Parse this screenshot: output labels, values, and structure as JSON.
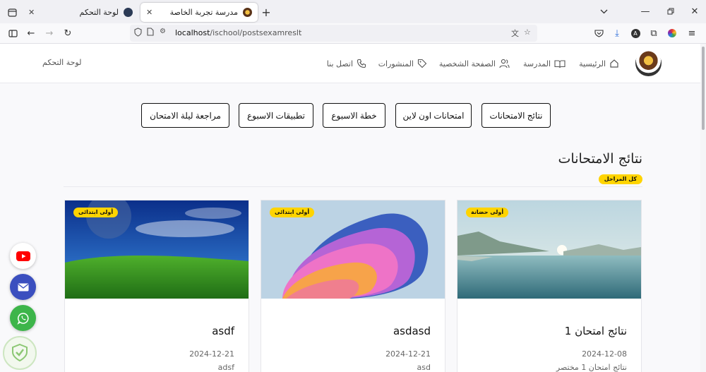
{
  "browser": {
    "tabs": [
      {
        "title": "لوحة التحكم",
        "active": false
      },
      {
        "title": "مدرسة تجربة الخاصة",
        "active": true
      }
    ],
    "url_host": "localhost",
    "url_path": "/ischool/postsexamreslt"
  },
  "header": {
    "menu": [
      {
        "label": "الرئيسية",
        "icon": "home-icon"
      },
      {
        "label": "المدرسة",
        "icon": "book-icon"
      },
      {
        "label": "الصفحة الشخصية",
        "icon": "users-icon"
      },
      {
        "label": "المنشورات",
        "icon": "tag-icon"
      },
      {
        "label": "اتصل بنا",
        "icon": "phone-icon"
      }
    ],
    "dashboard_link": "لوحة التحكم"
  },
  "categories": [
    "نتائج الامتحانات",
    "امتحانات اون لاين",
    "خطة الاسبوع",
    "تطبيقات الاسبوع",
    "مراجعة ليلة الامتحان"
  ],
  "section": {
    "title": "نتائج الامتحانات",
    "stage_filter": "كل المراحل"
  },
  "cards": [
    {
      "badge": "أولى حضانة",
      "title": "نتائج امتحان 1",
      "date": "2024-12-08",
      "desc": "نتائج امتحان 1 مختصر"
    },
    {
      "badge": "أولى ابتدائى",
      "title": "asdasd",
      "date": "2024-12-21",
      "desc": "asd"
    },
    {
      "badge": "أولى ابتدائى",
      "title": "asdf",
      "date": "2024-12-21",
      "desc": "adsf"
    }
  ],
  "colors": {
    "badge": "#ffd400",
    "youtube": "#ff0000",
    "mail": "#3b4fbf",
    "whatsapp": "#3db54a"
  }
}
